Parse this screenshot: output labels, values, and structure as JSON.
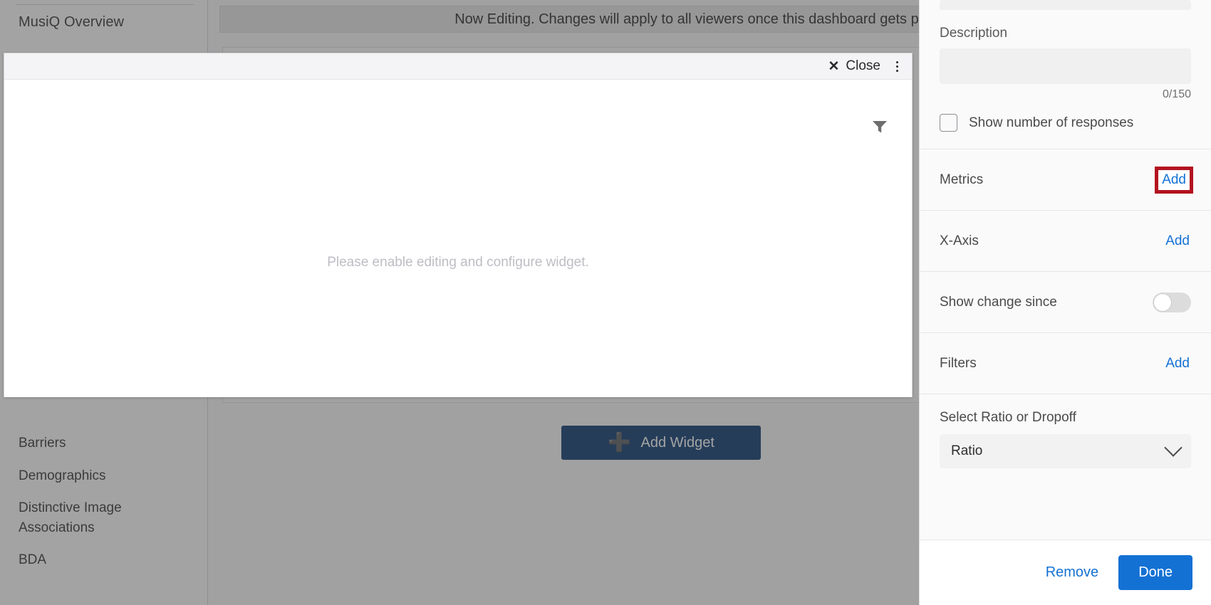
{
  "dashboard": {
    "sidebar": {
      "title": "MusiQ Overview",
      "items": [
        {
          "label": "Barriers"
        },
        {
          "label": "Demographics"
        },
        {
          "label": "Distinctive Image Associations"
        },
        {
          "label": "BDA"
        }
      ]
    },
    "edit_banner": "Now Editing. Changes will apply to all viewers once this dashboard gets published.",
    "add_widget_button": "Add Widget",
    "add_widget_icon": "plus-icon"
  },
  "modal": {
    "close_label": "Close",
    "close_icon": "close-x-icon",
    "menu_icon": "kebab-menu-icon",
    "filter_icon": "funnel-filter-icon",
    "placeholder_text": "Please enable editing and configure widget."
  },
  "config_panel": {
    "description": {
      "label": "Description",
      "value": "",
      "placeholder": "",
      "counter": "0/150"
    },
    "show_responses": {
      "label": "Show number of responses",
      "checked": false
    },
    "rows": [
      {
        "label": "Metrics",
        "action": "Add",
        "highlighted": true
      },
      {
        "label": "X-Axis",
        "action": "Add",
        "highlighted": false
      }
    ],
    "show_change_since": {
      "label": "Show change since",
      "enabled": false
    },
    "filters": {
      "label": "Filters",
      "action": "Add"
    },
    "ratio_select": {
      "label": "Select Ratio or Dropoff",
      "value": "Ratio",
      "chevron_icon": "chevron-down-icon"
    },
    "footer": {
      "remove_label": "Remove",
      "done_label": "Done"
    }
  },
  "colors": {
    "link_blue": "#1471d4",
    "primary_button": "#1471d4",
    "add_widget_button": "#123f73",
    "highlight_red": "#b3121f"
  }
}
